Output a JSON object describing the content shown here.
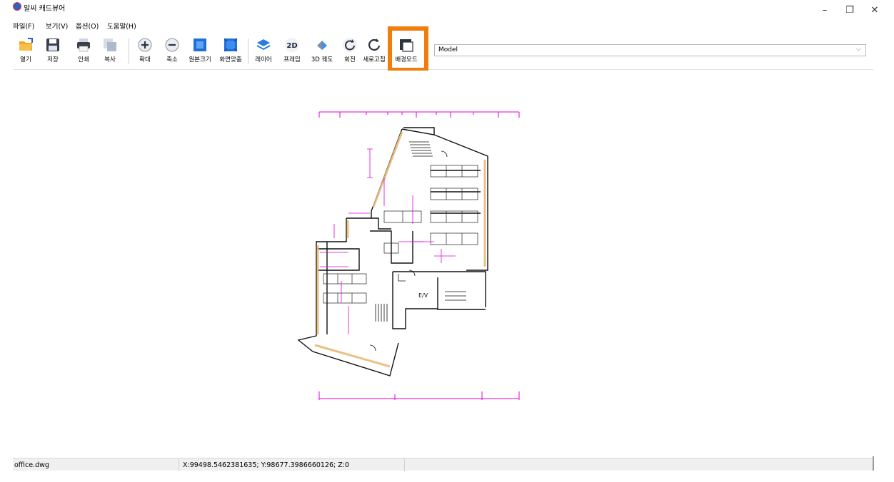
{
  "window": {
    "title": "알씨 캐드뷰어",
    "minimize": "–",
    "maximize": "❐",
    "close": "✕"
  },
  "menu": [
    "파일(F)",
    "보기(V)",
    "옵션(O)",
    "도움말(H)"
  ],
  "toolbar": {
    "buttons": [
      {
        "label": "열기",
        "icon": "folder-open-icon"
      },
      {
        "label": "저장",
        "icon": "save-disk-icon"
      },
      {
        "label": "인쇄",
        "icon": "printer-icon"
      },
      {
        "label": "복사",
        "icon": "copy-icon"
      },
      {
        "label": "확대",
        "icon": "zoom-in-icon"
      },
      {
        "label": "축소",
        "icon": "zoom-out-icon"
      },
      {
        "label": "원본크기",
        "icon": "original-size-icon"
      },
      {
        "label": "화면맞춤",
        "icon": "fit-screen-icon"
      },
      {
        "label": "레이어",
        "icon": "layers-icon"
      },
      {
        "label": "프레임",
        "icon": "frame-2d-icon"
      },
      {
        "label": "3D 궤도",
        "icon": "orbit-3d-icon"
      },
      {
        "label": "회전",
        "icon": "rotate-icon"
      },
      {
        "label": "새로고침",
        "icon": "refresh-icon"
      },
      {
        "label": "배경모드",
        "icon": "background-mode-icon"
      }
    ],
    "frame_icon_text": "2D",
    "model_select": {
      "value": "Model"
    }
  },
  "colors": {
    "highlight": "#f07d0c",
    "dimension": "#e000e0",
    "wall_fill": "#e8b97a"
  },
  "statusbar": {
    "file": "office.dwg",
    "coords": "X:99498.5462381635; Y:98677.3986660126; Z:0"
  }
}
